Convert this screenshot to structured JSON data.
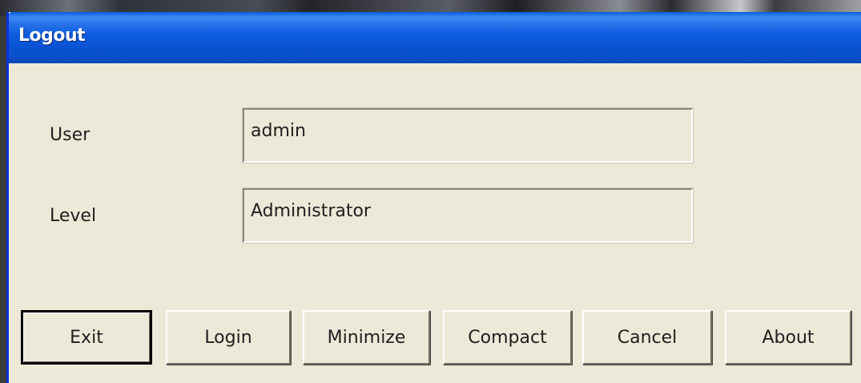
{
  "dialog": {
    "title": "Logout"
  },
  "form": {
    "user_label": "User",
    "user_value": "admin",
    "level_label": "Level",
    "level_value": "Administrator"
  },
  "buttons": [
    {
      "label": "Exit",
      "default": true
    },
    {
      "label": "Login"
    },
    {
      "label": "Minimize"
    },
    {
      "label": "Compact"
    },
    {
      "label": "Cancel"
    },
    {
      "label": "About"
    }
  ],
  "colors": {
    "titlebar": "#0a5bd8",
    "dialog_bg": "#ece9d8"
  }
}
